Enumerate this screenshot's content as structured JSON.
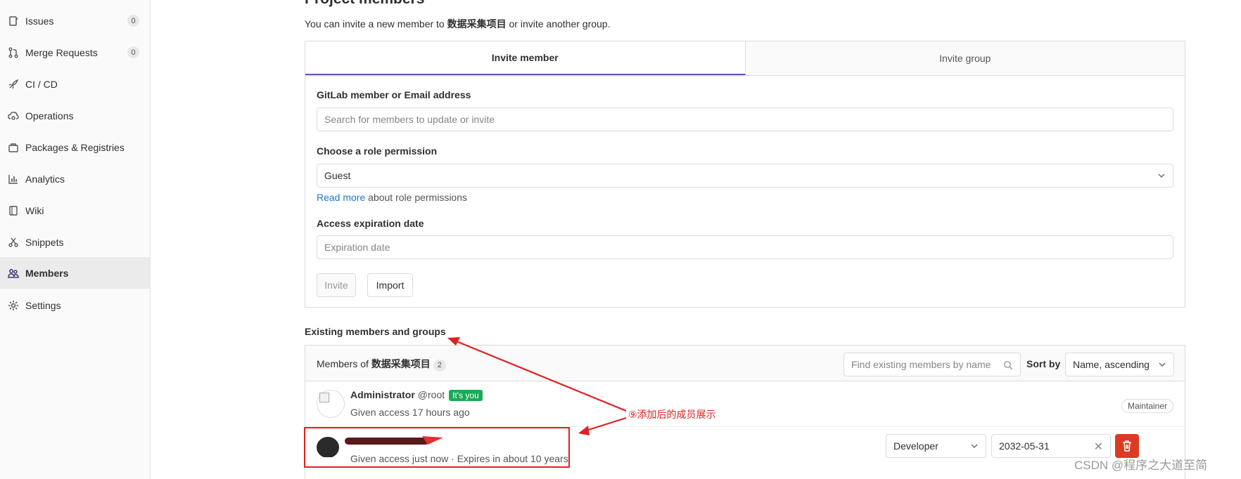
{
  "sidebar": {
    "items": [
      {
        "label": "Issues",
        "count": "0",
        "icon": "issues-icon"
      },
      {
        "label": "Merge Requests",
        "count": "0",
        "icon": "merge-request-icon"
      },
      {
        "label": "CI / CD",
        "icon": "rocket-icon"
      },
      {
        "label": "Operations",
        "icon": "cloud-gear-icon"
      },
      {
        "label": "Packages & Registries",
        "icon": "package-icon"
      },
      {
        "label": "Analytics",
        "icon": "chart-icon"
      },
      {
        "label": "Wiki",
        "icon": "book-icon"
      },
      {
        "label": "Snippets",
        "icon": "scissors-icon"
      },
      {
        "label": "Members",
        "icon": "users-icon",
        "active": true
      },
      {
        "label": "Settings",
        "icon": "gear-icon"
      }
    ]
  },
  "main": {
    "title": "Project members",
    "intro_prefix": "You can invite a new member to ",
    "project_name": "数据采集项目",
    "intro_suffix": " or invite another group.",
    "invite": {
      "tabs": [
        "Invite member",
        "Invite group"
      ],
      "member_label": "GitLab member or Email address",
      "member_placeholder": "Search for members to update or invite",
      "role_label": "Choose a role permission",
      "role_value": "Guest",
      "read_more_link": "Read more",
      "read_more_suffix": " about role permissions",
      "expiration_label": "Access expiration date",
      "expiration_placeholder": "Expiration date",
      "invite_button": "Invite",
      "import_button": "Import"
    },
    "existing": {
      "title": "Existing members and groups",
      "members_of_prefix": "Members of ",
      "project_name": "数据采集项目",
      "count": "2",
      "find_placeholder": "Find existing members by name",
      "sort_label": "Sort by",
      "sort_value": "Name, ascending",
      "members": [
        {
          "name": "Administrator",
          "handle": "@root",
          "badge": "It's you",
          "subtitle": "Given access 17 hours ago",
          "role": "Maintainer"
        },
        {
          "subtitle": "Given access just now · Expires in about 10 years",
          "role": "Developer",
          "expiration": "2032-05-31"
        }
      ]
    }
  },
  "annotation": {
    "text": "⑨添加后的成员展示",
    "color": "#e02020"
  },
  "watermark": "CSDN @程序之大道至简",
  "colors": {
    "accent_tab": "#6b4fbb",
    "link": "#1f78d1",
    "success": "#1aaa55",
    "danger": "#db3b21"
  }
}
